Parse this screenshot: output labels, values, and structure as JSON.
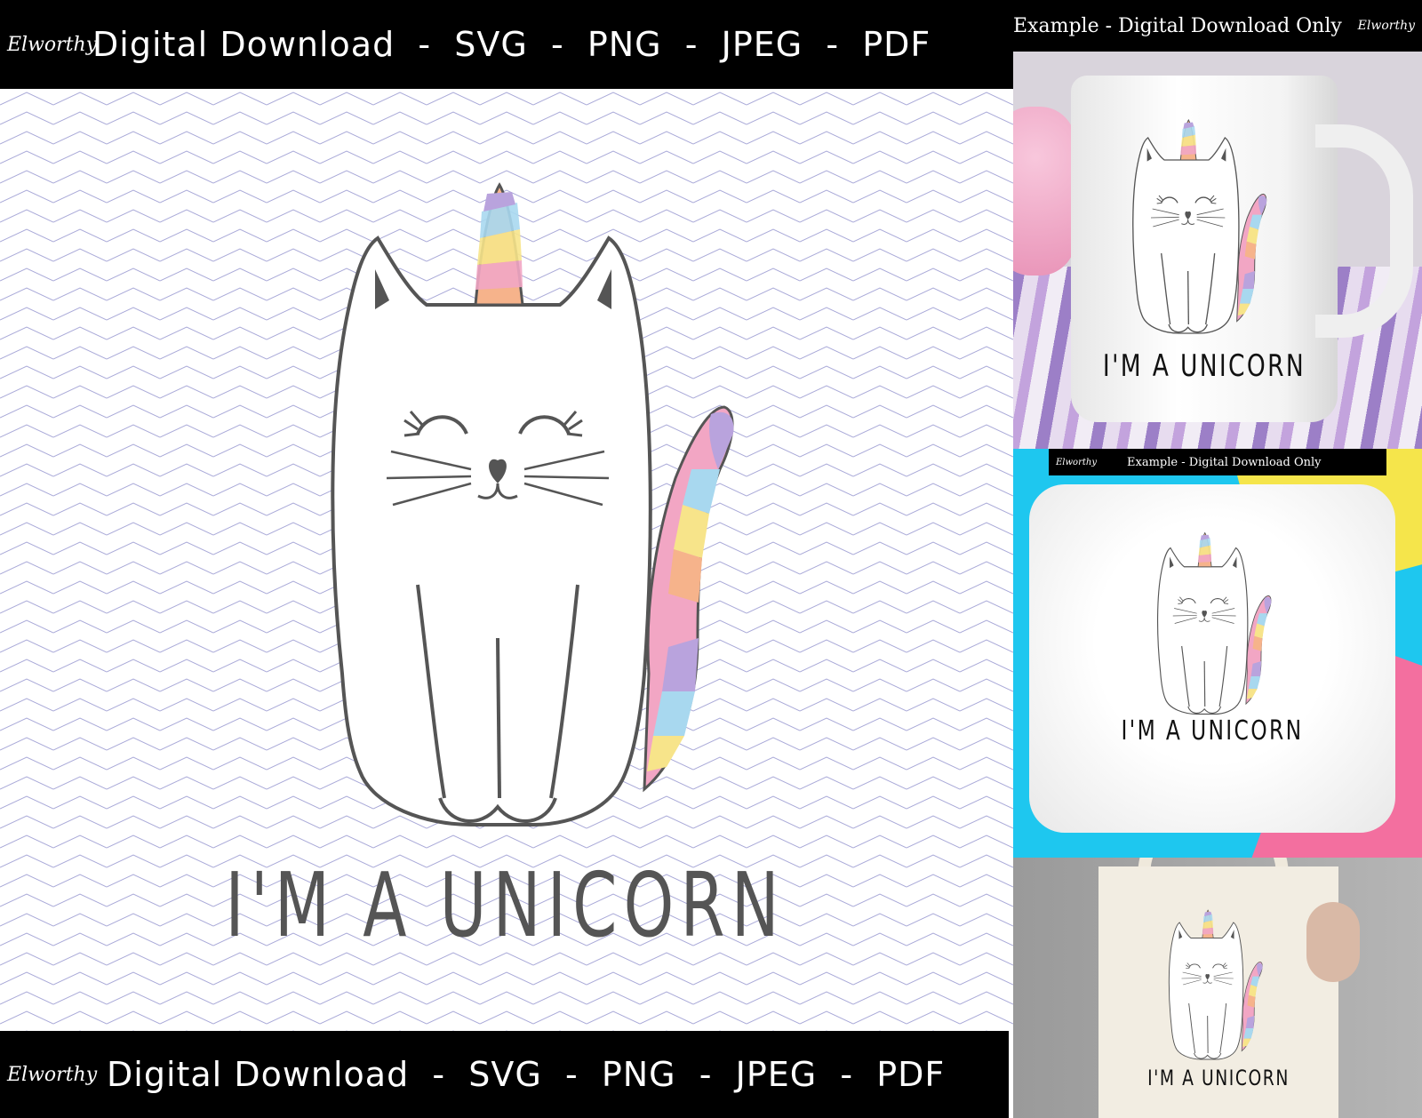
{
  "main": {
    "top_bar": {
      "logo": "Elworthy",
      "text": "Digital Download  -  SVG  -  PNG  -  JPEG  -  PDF"
    },
    "bottom_bar": {
      "logo": "Elworthy",
      "text": "Digital Download  -  SVG  -  PNG  -  JPEG  -  PDF"
    },
    "caption": "I'M A UNICORN"
  },
  "mockups": [
    {
      "product": "mug",
      "header": "Example - Digital Download Only",
      "logo": "Elworthy",
      "caption": "I'M A UNICORN"
    },
    {
      "product": "pillow",
      "header": "Example - Digital Download Only",
      "logo": "Elworthy",
      "caption": "I'M A UNICORN"
    },
    {
      "product": "tote-bag",
      "caption": "I'M A UNICORN"
    }
  ],
  "colors": {
    "line": "#555555",
    "rainbow": [
      "#b9a3dd",
      "#a8d8ef",
      "#f7e48a",
      "#f6b38b",
      "#f2a6c4",
      "#9fc7f0"
    ],
    "zigzag": "#a9a9d8"
  }
}
